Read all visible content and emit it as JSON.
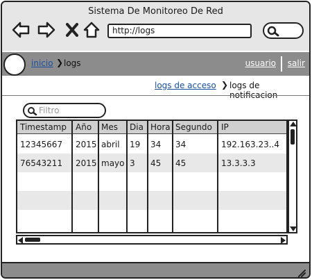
{
  "window": {
    "title": "Sistema De Monitoreo De Red"
  },
  "browser": {
    "url": "http://logs",
    "icons": [
      "back-arrow-icon",
      "forward-arrow-icon",
      "close-x-icon",
      "home-icon",
      "search-icon"
    ]
  },
  "menu": {
    "home_label": "inicio",
    "current_label": "logs",
    "user_label": "usuario",
    "logout_label": "salir",
    "separator": "❯"
  },
  "sub_nav": {
    "access_logs_label": "logs de acceso",
    "current_label": "logs de notificacion",
    "separator": "❯"
  },
  "filter": {
    "placeholder": "Filtro"
  },
  "table": {
    "columns": [
      "Timestamp",
      "Año",
      "Mes",
      "Dia",
      "Hora",
      "Segundo",
      "IP"
    ],
    "rows": [
      [
        "12345667",
        "2015",
        "abril",
        "19",
        "34",
        "34",
        "192.163.23..4"
      ],
      [
        "76543211",
        "2015",
        "mayo",
        "3",
        "45",
        "45",
        "13.3.3.3"
      ]
    ],
    "empty_rows": 3
  },
  "colors": {
    "chrome_gray": "#e6e6e6",
    "bar_gray": "#8c8c8c",
    "link_blue": "#1a4fa0",
    "header_gray": "#d0d0d0"
  }
}
